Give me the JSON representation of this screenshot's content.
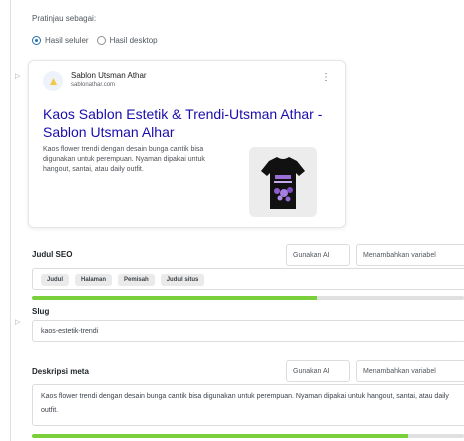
{
  "preview": {
    "label": "Pratinjau sebagai:",
    "options": [
      {
        "label": "Hasil seluler",
        "checked": true
      },
      {
        "label": "Hasil desktop",
        "checked": false
      }
    ]
  },
  "serp": {
    "site_name": "Sablon Utsman Athar",
    "site_url": "sablonathar.com",
    "menu_icon": "more-vertical-icon",
    "title": "Kaos Sablon Estetik & Trendi-Utsman Athar - Sablon Utsman Alhar",
    "description": "Kaos flower trendi dengan desain bunga cantik bisa digunakan untuk perempuan. Nyaman dipakai untuk hangout, santai, atau daily outfit."
  },
  "seo_title": {
    "label": "Judul SEO",
    "ai_button": "Gunakan AI",
    "add_var_button": "Menambahkan variabel",
    "chips": [
      "Judul",
      "Halaman",
      "Pemisah",
      "Judul situs"
    ],
    "progress": 0.66
  },
  "slug": {
    "label": "Slug",
    "value": "kaos-estetik-trendi"
  },
  "meta": {
    "label": "Deskripsi meta",
    "ai_button": "Gunakan AI",
    "add_var_button": "Menambahkan variabel",
    "value": "Kaos flower trendi dengan desain bunga cantik bisa digunakan untuk perempuan. Nyaman dipakai untuk hangout, santai, atau daily outfit.",
    "progress": 0.87
  },
  "colors": {
    "link": "#1a0dab",
    "progress_good": "#7ad03a",
    "radio_accent": "#2271b1"
  }
}
